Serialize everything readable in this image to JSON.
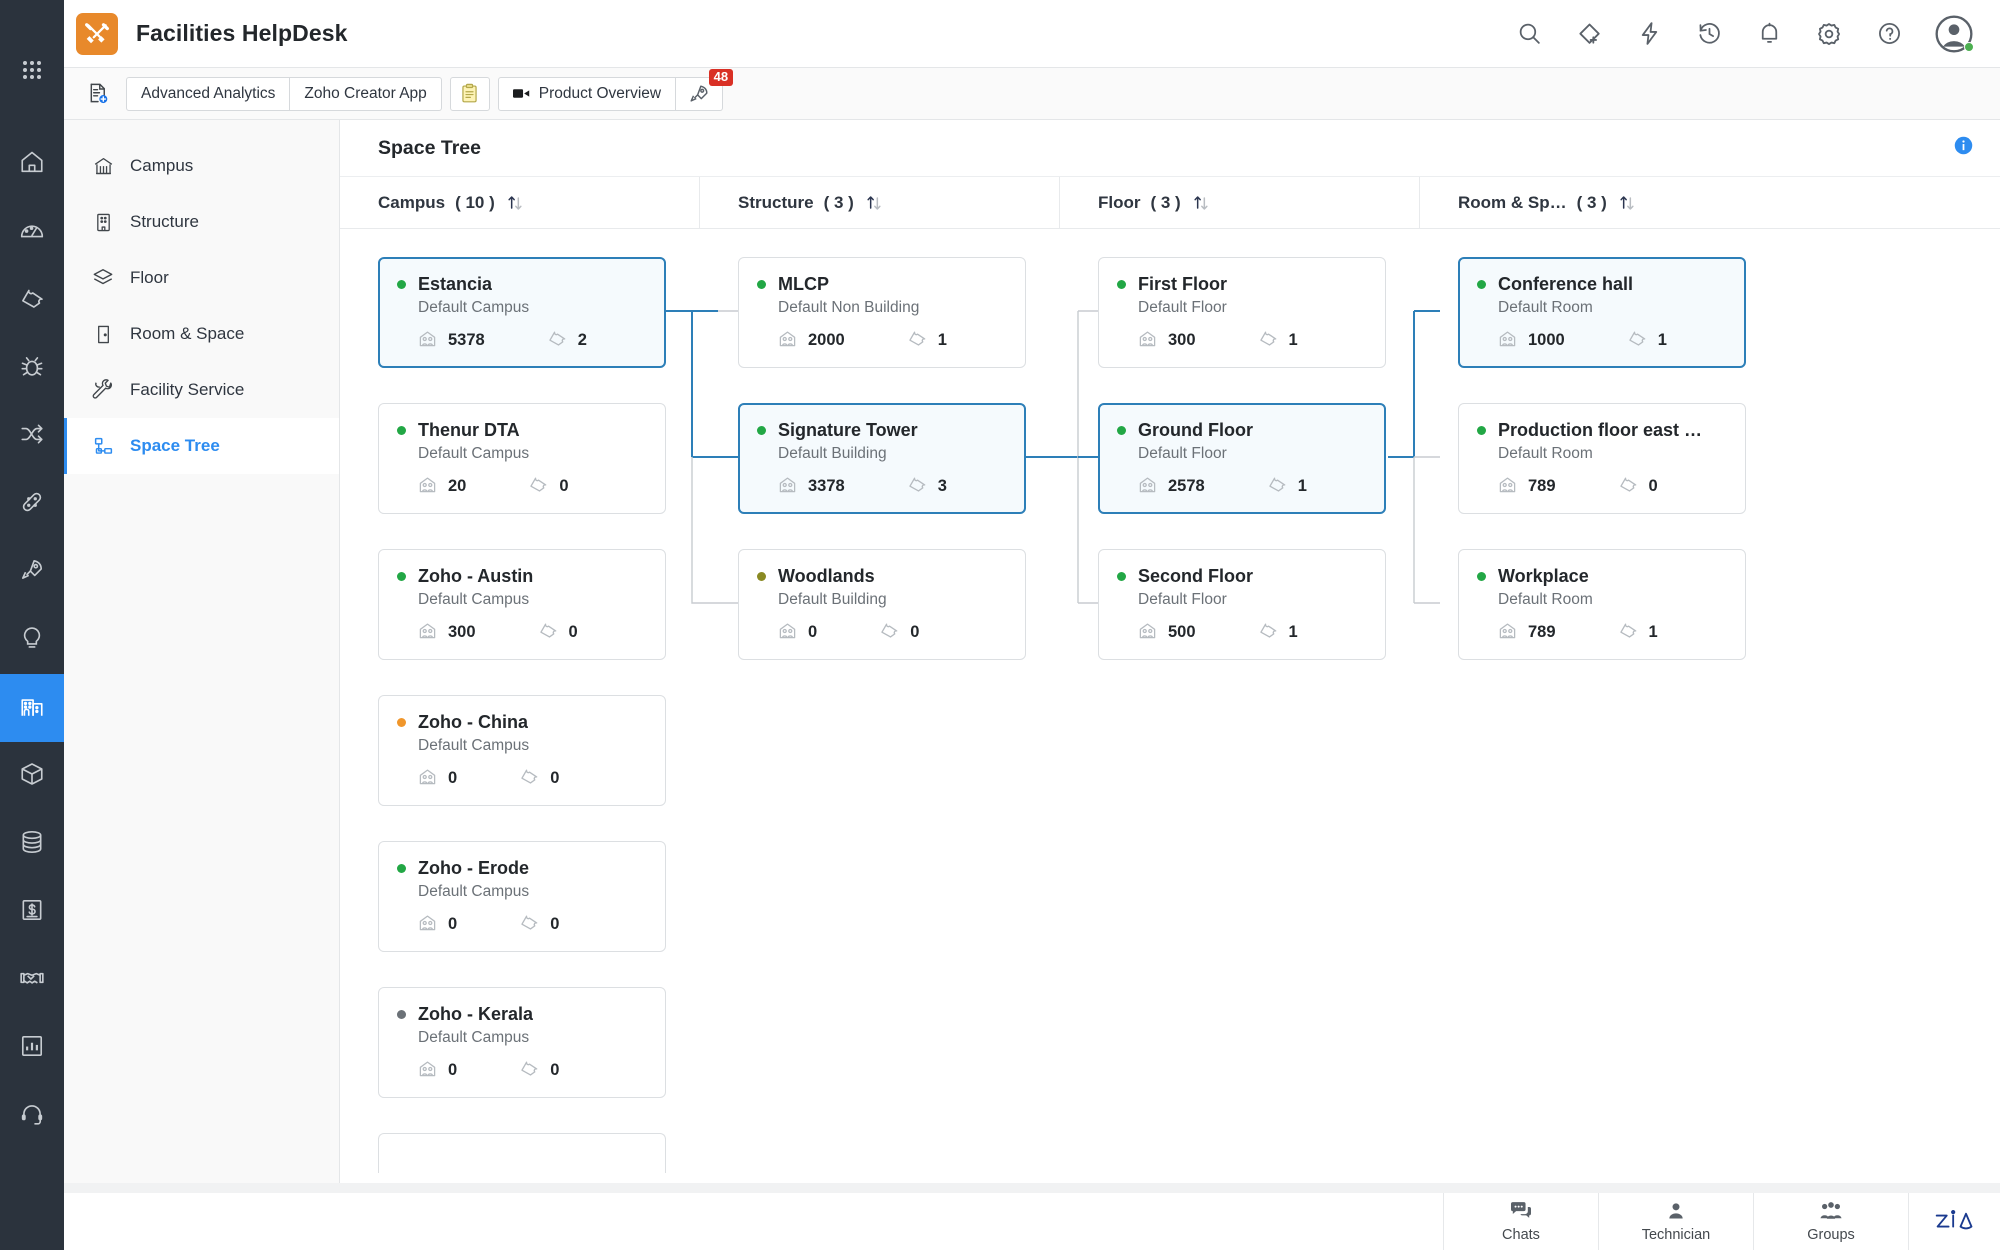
{
  "header": {
    "app_title": "Facilities HelpDesk",
    "logo_icon": "tools-icon",
    "logo_color": "#e8892b",
    "right_icons": [
      {
        "name": "search-icon",
        "label": "Search"
      },
      {
        "name": "add-ticket-icon",
        "label": "Add Ticket"
      },
      {
        "name": "flash-icon",
        "label": "Quick Actions"
      },
      {
        "name": "history-icon",
        "label": "Recent Activity"
      },
      {
        "name": "bell-icon",
        "label": "Notifications"
      },
      {
        "name": "gear-icon",
        "label": "Setup"
      },
      {
        "name": "help-icon",
        "label": "Help"
      }
    ],
    "avatar_status_color": "#4caf50"
  },
  "toolbar": {
    "new_report_icon": "new-report-icon",
    "buttons": [
      {
        "name": "advanced-analytics-button",
        "label": "Advanced Analytics"
      },
      {
        "name": "zoho-creator-app-button",
        "label": "Zoho Creator App"
      }
    ],
    "clipboard_icon": "clipboard-icon",
    "product_overview": {
      "label": "Product Overview",
      "icon": "video-camera-icon"
    },
    "rocket": {
      "icon": "rocket-icon",
      "badge": "48",
      "badge_color": "#d93025"
    }
  },
  "rail": {
    "items": [
      {
        "name": "rail-item-home",
        "icon": "home-icon",
        "active": false
      },
      {
        "name": "rail-item-dashboard",
        "icon": "gauge-icon",
        "active": false
      },
      {
        "name": "rail-item-tickets",
        "icon": "ticket-icon",
        "active": false
      },
      {
        "name": "rail-item-problems",
        "icon": "bug-icon",
        "active": false
      },
      {
        "name": "rail-item-changes",
        "icon": "shuffle-icon",
        "active": false
      },
      {
        "name": "rail-item-releases",
        "icon": "bandage-icon",
        "active": false
      },
      {
        "name": "rail-item-projects",
        "icon": "rocket-icon",
        "active": false
      },
      {
        "name": "rail-item-solutions",
        "icon": "lightbulb-icon",
        "active": false
      },
      {
        "name": "rail-item-facilities",
        "icon": "building-icon",
        "active": true
      },
      {
        "name": "rail-item-assets",
        "icon": "cube-icon",
        "active": false
      },
      {
        "name": "rail-item-cmdb",
        "icon": "database-icon",
        "active": false
      },
      {
        "name": "rail-item-purchase",
        "icon": "money-icon",
        "active": false
      },
      {
        "name": "rail-item-contracts",
        "icon": "handshake-icon",
        "active": false
      },
      {
        "name": "rail-item-reports",
        "icon": "bar-chart-icon",
        "active": false
      },
      {
        "name": "rail-item-support",
        "icon": "headset-icon",
        "active": false
      }
    ],
    "active_bg": "#2d8cf0"
  },
  "subnav": {
    "items": [
      {
        "name": "sidebar-item-campus",
        "label": "Campus",
        "icon": "campus-icon",
        "active": false
      },
      {
        "name": "sidebar-item-structure",
        "label": "Structure",
        "icon": "structure-icon",
        "active": false
      },
      {
        "name": "sidebar-item-floor",
        "label": "Floor",
        "icon": "layers-icon",
        "active": false
      },
      {
        "name": "sidebar-item-room-space",
        "label": "Room & Space",
        "icon": "door-icon",
        "active": false
      },
      {
        "name": "sidebar-item-facility-service",
        "label": "Facility Service",
        "icon": "wrench-icon",
        "active": false
      },
      {
        "name": "sidebar-item-space-tree",
        "label": "Space Tree",
        "icon": "tree-nodes-icon",
        "active": true
      }
    ],
    "accent_color": "#2d8cf0"
  },
  "pane": {
    "title": "Space Tree",
    "info_icon": "info-icon",
    "columns": [
      {
        "name": "column-header-campus",
        "label": "Campus",
        "count": "( 10 )"
      },
      {
        "name": "column-header-structure",
        "label": "Structure",
        "count": "( 3 )"
      },
      {
        "name": "column-header-floor",
        "label": "Floor",
        "count": "( 3 )"
      },
      {
        "name": "column-header-room-space",
        "label": "Room & Sp…",
        "count": "( 3 )"
      }
    ]
  },
  "tree": {
    "occupancy_icon": "occupancy-icon",
    "ticket_icon": "ticket-icon",
    "selected_border_color": "#2d7fb8",
    "selected_bg_color": "#f5fafd",
    "columns": [
      {
        "key": "campus",
        "cards": [
          {
            "title": "Estancia",
            "subtitle": "Default Campus",
            "occupancy": "5378",
            "tickets": "2",
            "dot": "#22a745",
            "selected": true
          },
          {
            "title": "Thenur DTA",
            "subtitle": "Default Campus",
            "occupancy": "20",
            "tickets": "0",
            "dot": "#22a745",
            "selected": false
          },
          {
            "title": "Zoho - Austin",
            "subtitle": "Default Campus",
            "occupancy": "300",
            "tickets": "0",
            "dot": "#22a745",
            "selected": false
          },
          {
            "title": "Zoho - China",
            "subtitle": "Default Campus",
            "occupancy": "0",
            "tickets": "0",
            "dot": "#f0962b",
            "selected": false
          },
          {
            "title": "Zoho - Erode",
            "subtitle": "Default Campus",
            "occupancy": "0",
            "tickets": "0",
            "dot": "#22a745",
            "selected": false
          },
          {
            "title": "Zoho - Kerala",
            "subtitle": "Default Campus",
            "occupancy": "0",
            "tickets": "0",
            "dot": "#6b7177",
            "selected": false
          }
        ]
      },
      {
        "key": "structure",
        "cards": [
          {
            "title": "MLCP",
            "subtitle": "Default Non Building",
            "occupancy": "2000",
            "tickets": "1",
            "dot": "#22a745",
            "selected": false
          },
          {
            "title": "Signature Tower",
            "subtitle": "Default Building",
            "occupancy": "3378",
            "tickets": "3",
            "dot": "#22a745",
            "selected": true
          },
          {
            "title": "Woodlands",
            "subtitle": "Default Building",
            "occupancy": "0",
            "tickets": "0",
            "dot": "#8a8a23",
            "selected": false
          }
        ]
      },
      {
        "key": "floor",
        "cards": [
          {
            "title": "First Floor",
            "subtitle": "Default Floor",
            "occupancy": "300",
            "tickets": "1",
            "dot": "#22a745",
            "selected": false
          },
          {
            "title": "Ground Floor",
            "subtitle": "Default Floor",
            "occupancy": "2578",
            "tickets": "1",
            "dot": "#22a745",
            "selected": true
          },
          {
            "title": "Second Floor",
            "subtitle": "Default Floor",
            "occupancy": "500",
            "tickets": "1",
            "dot": "#22a745",
            "selected": false
          }
        ]
      },
      {
        "key": "room",
        "cards": [
          {
            "title": "Conference hall",
            "subtitle": "Default Room",
            "occupancy": "1000",
            "tickets": "1",
            "dot": "#22a745",
            "selected": true
          },
          {
            "title": "Production floor east w…",
            "subtitle": "Default Room",
            "occupancy": "789",
            "tickets": "0",
            "dot": "#22a745",
            "selected": false
          },
          {
            "title": "Workplace",
            "subtitle": "Default Room",
            "occupancy": "789",
            "tickets": "1",
            "dot": "#22a745",
            "selected": false
          }
        ]
      }
    ]
  },
  "footer": {
    "items": [
      {
        "name": "footer-chats",
        "label": "Chats",
        "icon": "chat-icon"
      },
      {
        "name": "footer-technician",
        "label": "Technician",
        "icon": "user-icon"
      },
      {
        "name": "footer-groups",
        "label": "Groups",
        "icon": "group-icon"
      }
    ],
    "zia_logo": "zia-logo"
  }
}
